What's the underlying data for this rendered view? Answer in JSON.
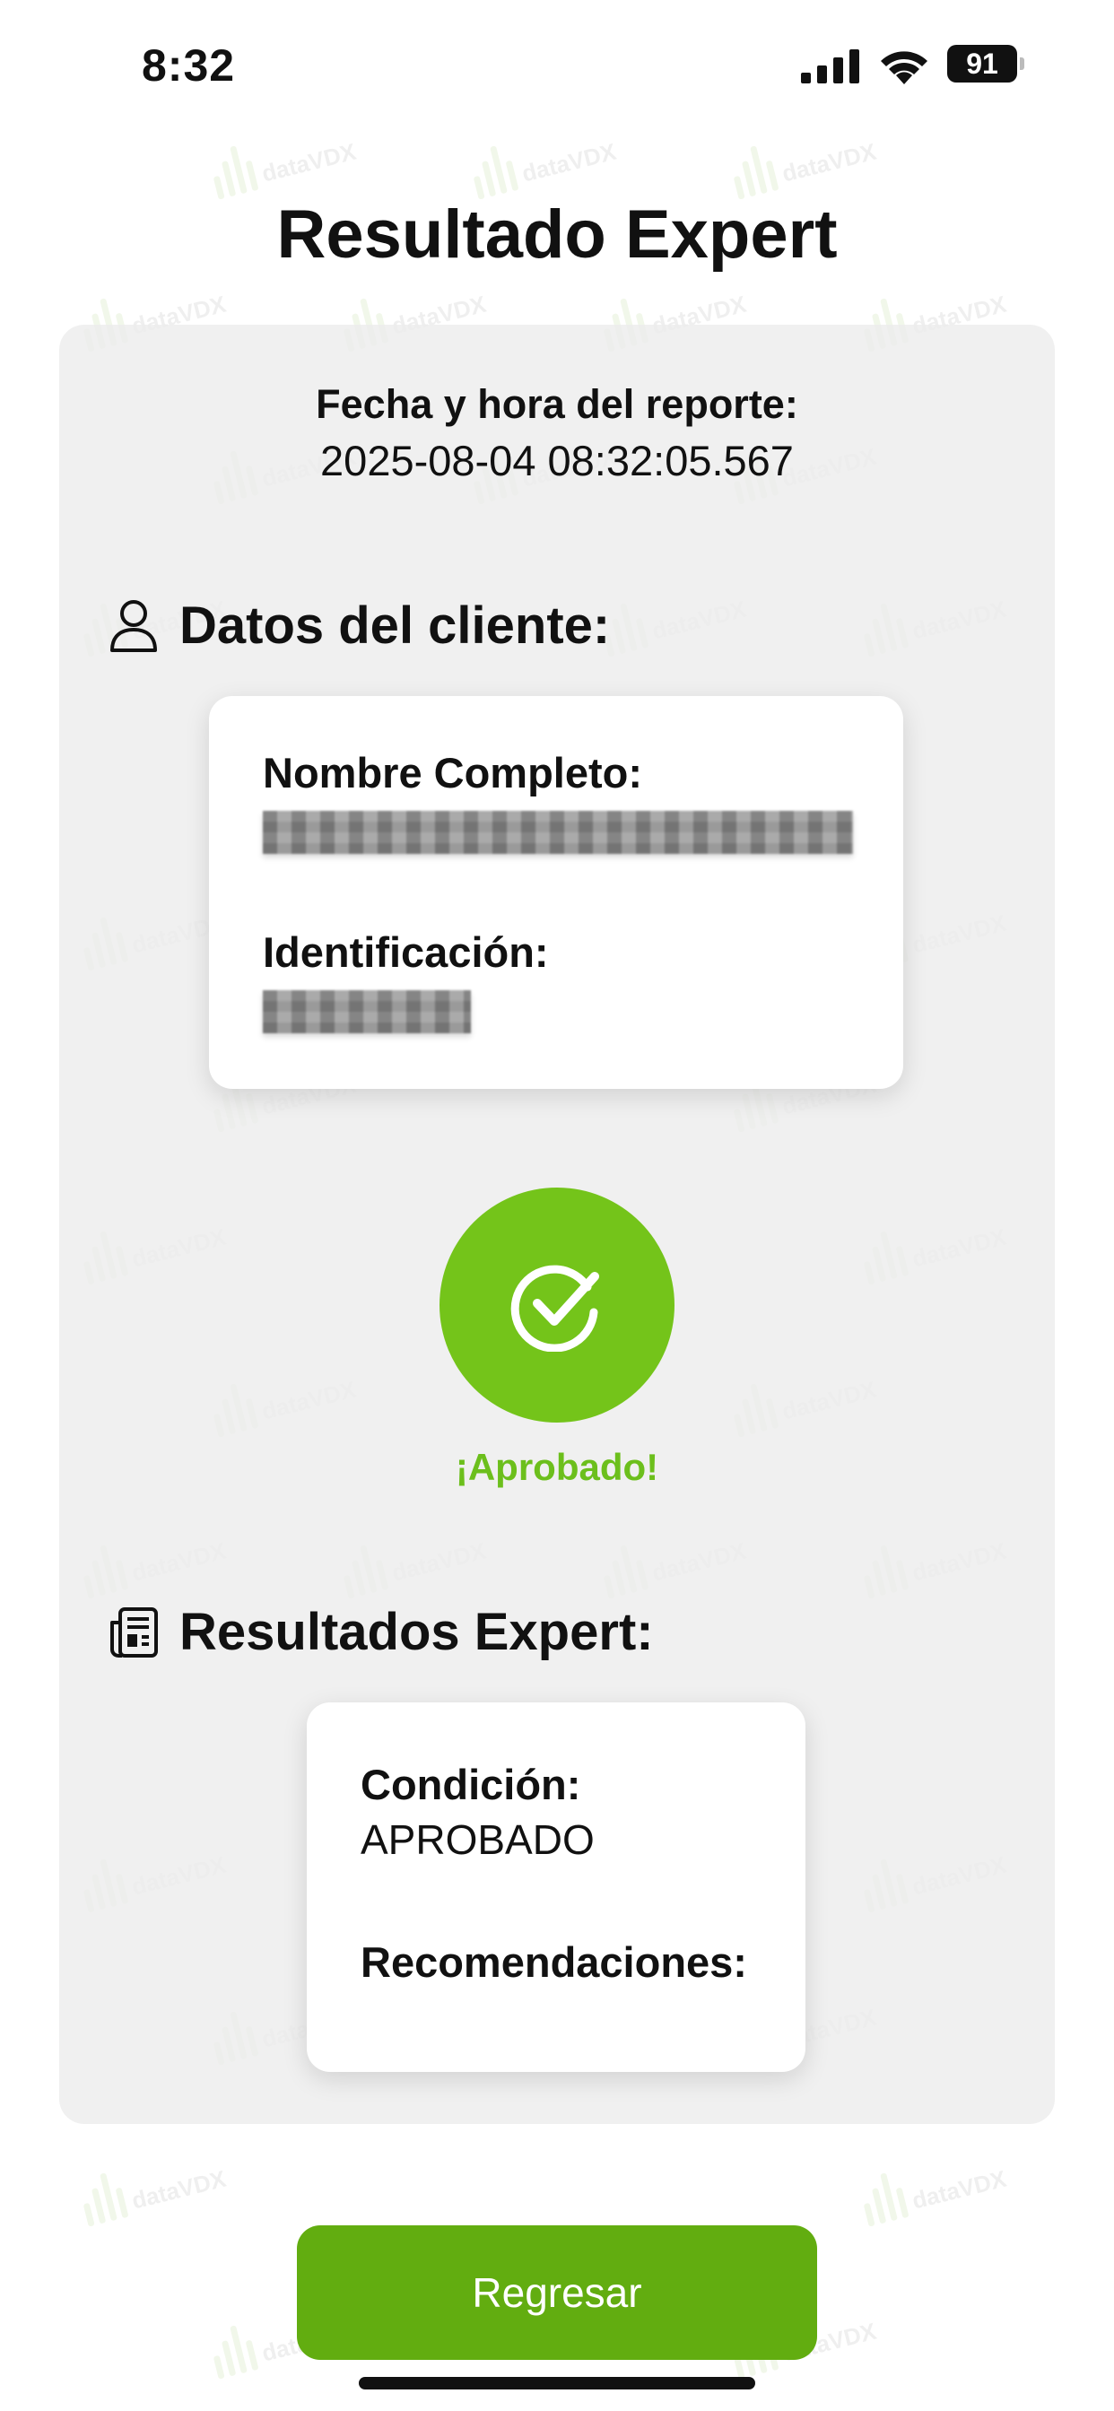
{
  "status_bar": {
    "time": "8:32",
    "battery_level": "91"
  },
  "page": {
    "title": "Resultado Expert"
  },
  "report": {
    "date_label": "Fecha y hora del reporte:",
    "date_value": "2025-08-04 08:32:05.567"
  },
  "client_section": {
    "title": "Datos del cliente:",
    "icon": "person-icon",
    "name_label": "Nombre Completo:",
    "id_label": "Identificación:"
  },
  "result": {
    "status_text": "¡Aprobado!",
    "icon": "check-circle-icon",
    "color": "#74c41a"
  },
  "expert_section": {
    "title": "Resultados Expert:",
    "icon": "newspaper-icon",
    "condition_label": "Condición:",
    "condition_value": "APROBADO",
    "recommendations_label": "Recomendaciones:"
  },
  "actions": {
    "back_label": "Regresar",
    "accent_color": "#62ad10"
  },
  "watermark": {
    "text": "dataVDX"
  }
}
